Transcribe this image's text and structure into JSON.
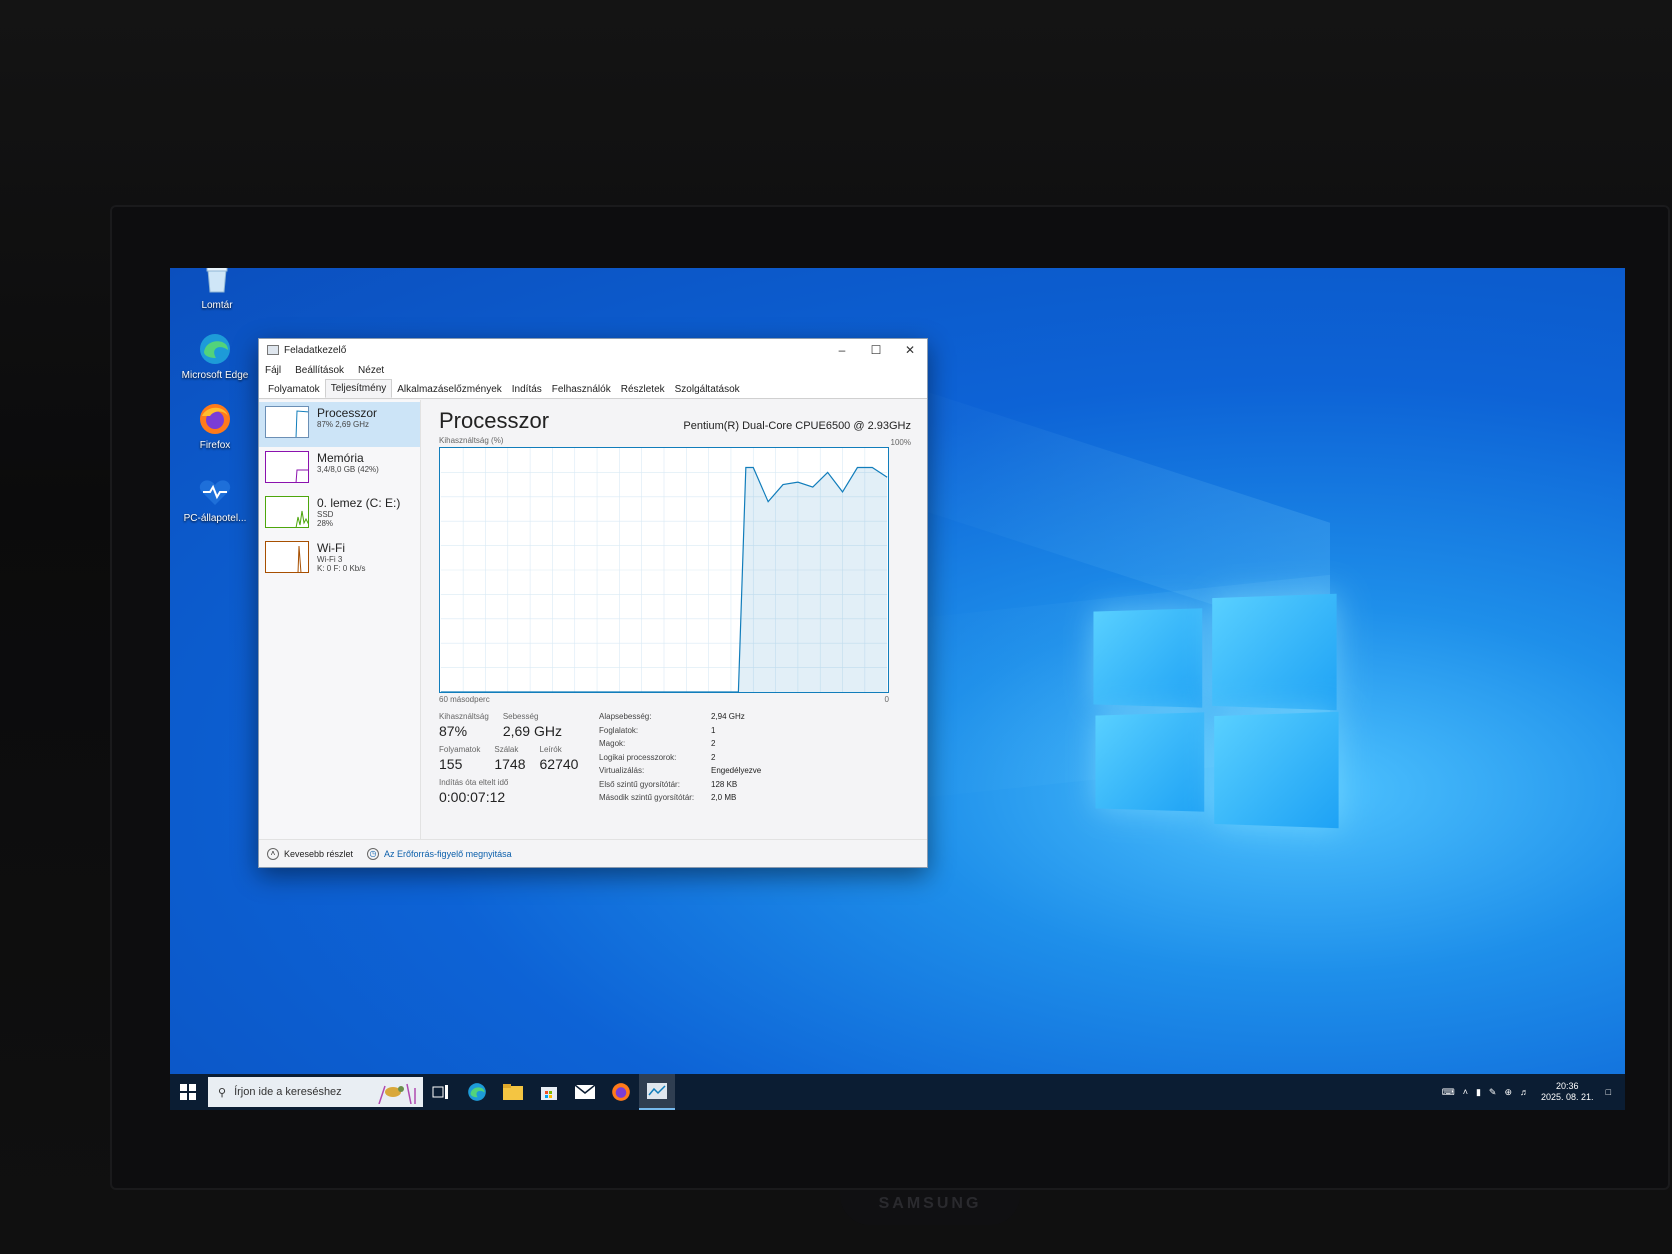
{
  "desktop": {
    "icons": [
      {
        "label": "Lomtár",
        "icon": "recycle-bin-icon"
      },
      {
        "label": "Microsoft Edge",
        "icon": "edge-icon"
      },
      {
        "label": "Firefox",
        "icon": "firefox-icon"
      },
      {
        "label": "PC-állapotel...",
        "icon": "pc-health-icon"
      }
    ]
  },
  "taskmgr": {
    "title": "Feladatkezelő",
    "menu": [
      "Fájl",
      "Beállítások",
      "Nézet"
    ],
    "tabs": [
      "Folyamatok",
      "Teljesítmény",
      "Alkalmazáselőzmények",
      "Indítás",
      "Felhasználók",
      "Részletek",
      "Szolgáltatások"
    ],
    "active_tab": "Teljesítmény",
    "sidebar": [
      {
        "name": "Processzor",
        "sub1": "87% 2,69 GHz",
        "sub2": ""
      },
      {
        "name": "Memória",
        "sub1": "3,4/8,0 GB (42%)",
        "sub2": ""
      },
      {
        "name": "0. lemez (C: E:)",
        "sub1": "SSD",
        "sub2": "28%"
      },
      {
        "name": "Wi-Fi",
        "sub1": "Wi-Fi 3",
        "sub2": "K: 0 F: 0 Kb/s"
      }
    ],
    "cpu": {
      "heading": "Processzor",
      "model": "Pentium(R) Dual-Core CPUE6500 @ 2.93GHz",
      "graph_label": "Kihasználtság (%)",
      "graph_max": "100%",
      "graph_time": "60 másodperc",
      "graph_min": "0",
      "stats": {
        "util_label": "Kihasználtság",
        "util_value": "87%",
        "speed_label": "Sebesség",
        "speed_value": "2,69 GHz",
        "proc_label": "Folyamatok",
        "proc_value": "155",
        "threads_label": "Szálak",
        "threads_value": "1748",
        "handles_label": "Leírók",
        "handles_value": "62740",
        "uptime_label": "Indítás óta eltelt idő",
        "uptime_value": "0:00:07:12"
      },
      "details": [
        {
          "k": "Alapsebesség:",
          "v": "2,94 GHz"
        },
        {
          "k": "Foglalatok:",
          "v": "1"
        },
        {
          "k": "Magok:",
          "v": "2"
        },
        {
          "k": "Logikai processzorok:",
          "v": "2"
        },
        {
          "k": "Virtualizálás:",
          "v": "Engedélyezve"
        },
        {
          "k": "Első szintű gyorsítótár:",
          "v": "128 KB"
        },
        {
          "k": "Második szintű gyorsítótár:",
          "v": "2,0 MB"
        }
      ]
    },
    "footer": {
      "less": "Kevesebb részlet",
      "resmon": "Az Erőforrás-figyelő megnyitása"
    }
  },
  "chart_data": {
    "type": "line",
    "ylabel": "Kihasználtság (%)",
    "xlabel": "60 másodperc",
    "ylim": [
      0,
      100
    ],
    "x": [
      0,
      40,
      41,
      42,
      44,
      46,
      48,
      50,
      52,
      54,
      56,
      58,
      60
    ],
    "values": [
      0,
      0,
      92,
      92,
      78,
      85,
      86,
      84,
      90,
      82,
      92,
      92,
      88
    ]
  },
  "taskbar": {
    "search_placeholder": "Írjon ide a kereséshez",
    "time": "20:36",
    "date": "2025. 08. 21.",
    "apps": [
      "task-view-icon",
      "edge-icon",
      "file-explorer-icon",
      "store-icon",
      "mail-icon",
      "firefox-icon",
      "task-manager-icon"
    ]
  },
  "monitor": {
    "brand": "SAMSUNG"
  },
  "colors": {
    "accent": "#117dbb",
    "taskbar": "#0b1d33",
    "desktop": "#0d63d6"
  }
}
